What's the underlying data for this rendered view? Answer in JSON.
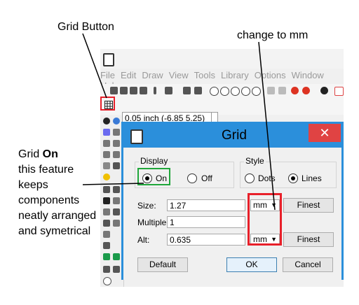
{
  "annotations": {
    "grid_button": "Grid Button",
    "change_mm": "change to mm",
    "grid_on_line1": "Grid ",
    "grid_on_bold": "On",
    "grid_on_rest": "this feature keeps components neatly arranged and symetrical"
  },
  "menu": [
    "File",
    "Edit",
    "Draw",
    "View",
    "Tools",
    "Library",
    "Options",
    "Window",
    "Help"
  ],
  "coord_field": "0.05 inch (-6.85 5.25)",
  "dialog": {
    "title": "Grid",
    "close": "✕",
    "display_label": "Display",
    "style_label": "Style",
    "on_label": "On",
    "off_label": "Off",
    "dots_label": "Dots",
    "lines_label": "Lines",
    "size_label": "Size:",
    "size_value": "1.27",
    "size_unit": "mm",
    "multiple_label": "Multiple:",
    "multiple_value": "1",
    "alt_label": "Alt:",
    "alt_value": "0.635",
    "alt_unit": "mm",
    "finest_label": "Finest",
    "default_label": "Default",
    "ok_label": "OK",
    "cancel_label": "Cancel"
  },
  "colors": {
    "title_bar": "#2b8fdb",
    "close": "#e04343",
    "highlight_red": "#e8202a",
    "highlight_green": "#1fa63a"
  }
}
